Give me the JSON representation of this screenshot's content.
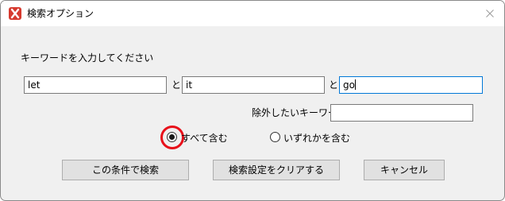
{
  "window": {
    "title": "検索オプション",
    "app_icon": "app-x-icon",
    "close_icon": "close-icon"
  },
  "form": {
    "prompt": "キーワードを入力してください",
    "keywords": [
      "let",
      "it",
      "go"
    ],
    "connector_1": "と",
    "connector_2": "と",
    "exclude_label": "除外したいキーワード",
    "exclude_value": ""
  },
  "options": {
    "all_label": "すべて含む",
    "any_label": "いずれかを含む",
    "selected": "all"
  },
  "buttons": {
    "search": "この条件で検索",
    "clear": "検索設定をクリアする",
    "cancel": "キャンセル"
  },
  "colors": {
    "highlight": "#e8101a",
    "focus_border": "#0078d7",
    "app_icon_bg": "#d63a2f"
  }
}
